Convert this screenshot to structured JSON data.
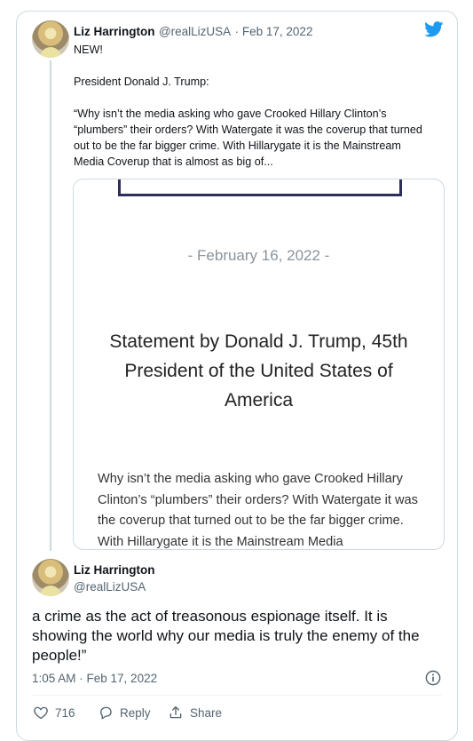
{
  "tweet": {
    "author_name": "Liz Harrington",
    "author_handle": "@realLizUSA",
    "date": "· Feb 17, 2022",
    "paragraphs": [
      "NEW!",
      "President Donald J. Trump:",
      "“Why isn’t the media asking who gave Crooked Hillary Clinton’s “plumbers” their orders? With Watergate it was the coverup that turned out to be the far bigger crime. With Hillarygate it is the Mainstream Media Coverup that is almost as big of..."
    ],
    "embed": {
      "date": "- February 16, 2022 -",
      "title": "Statement by Donald J. Trump, 45th President of the United States of America",
      "body": "Why isn’t the media asking who gave Crooked Hillary Clinton’s “plumbers” their orders? With Watergate it was the coverup that turned out to be the far bigger crime. With Hillarygate it is the Mainstream Media"
    }
  },
  "reply": {
    "author_name": "Liz Harrington",
    "author_handle": "@realLizUSA",
    "text": "a crime as the act of treasonous espionage itself. It is showing the world why our media is truly the enemy of the people!”",
    "timestamp": "1:05 AM · Feb 17, 2022",
    "likes": "716",
    "reply_label": "Reply",
    "share_label": "Share"
  },
  "colors": {
    "accent": "#1d9bf0",
    "muted": "#536471",
    "border": "#cfd9de"
  },
  "icons": [
    "twitter-bird-icon",
    "info-icon",
    "heart-icon",
    "reply-icon",
    "share-icon"
  ]
}
